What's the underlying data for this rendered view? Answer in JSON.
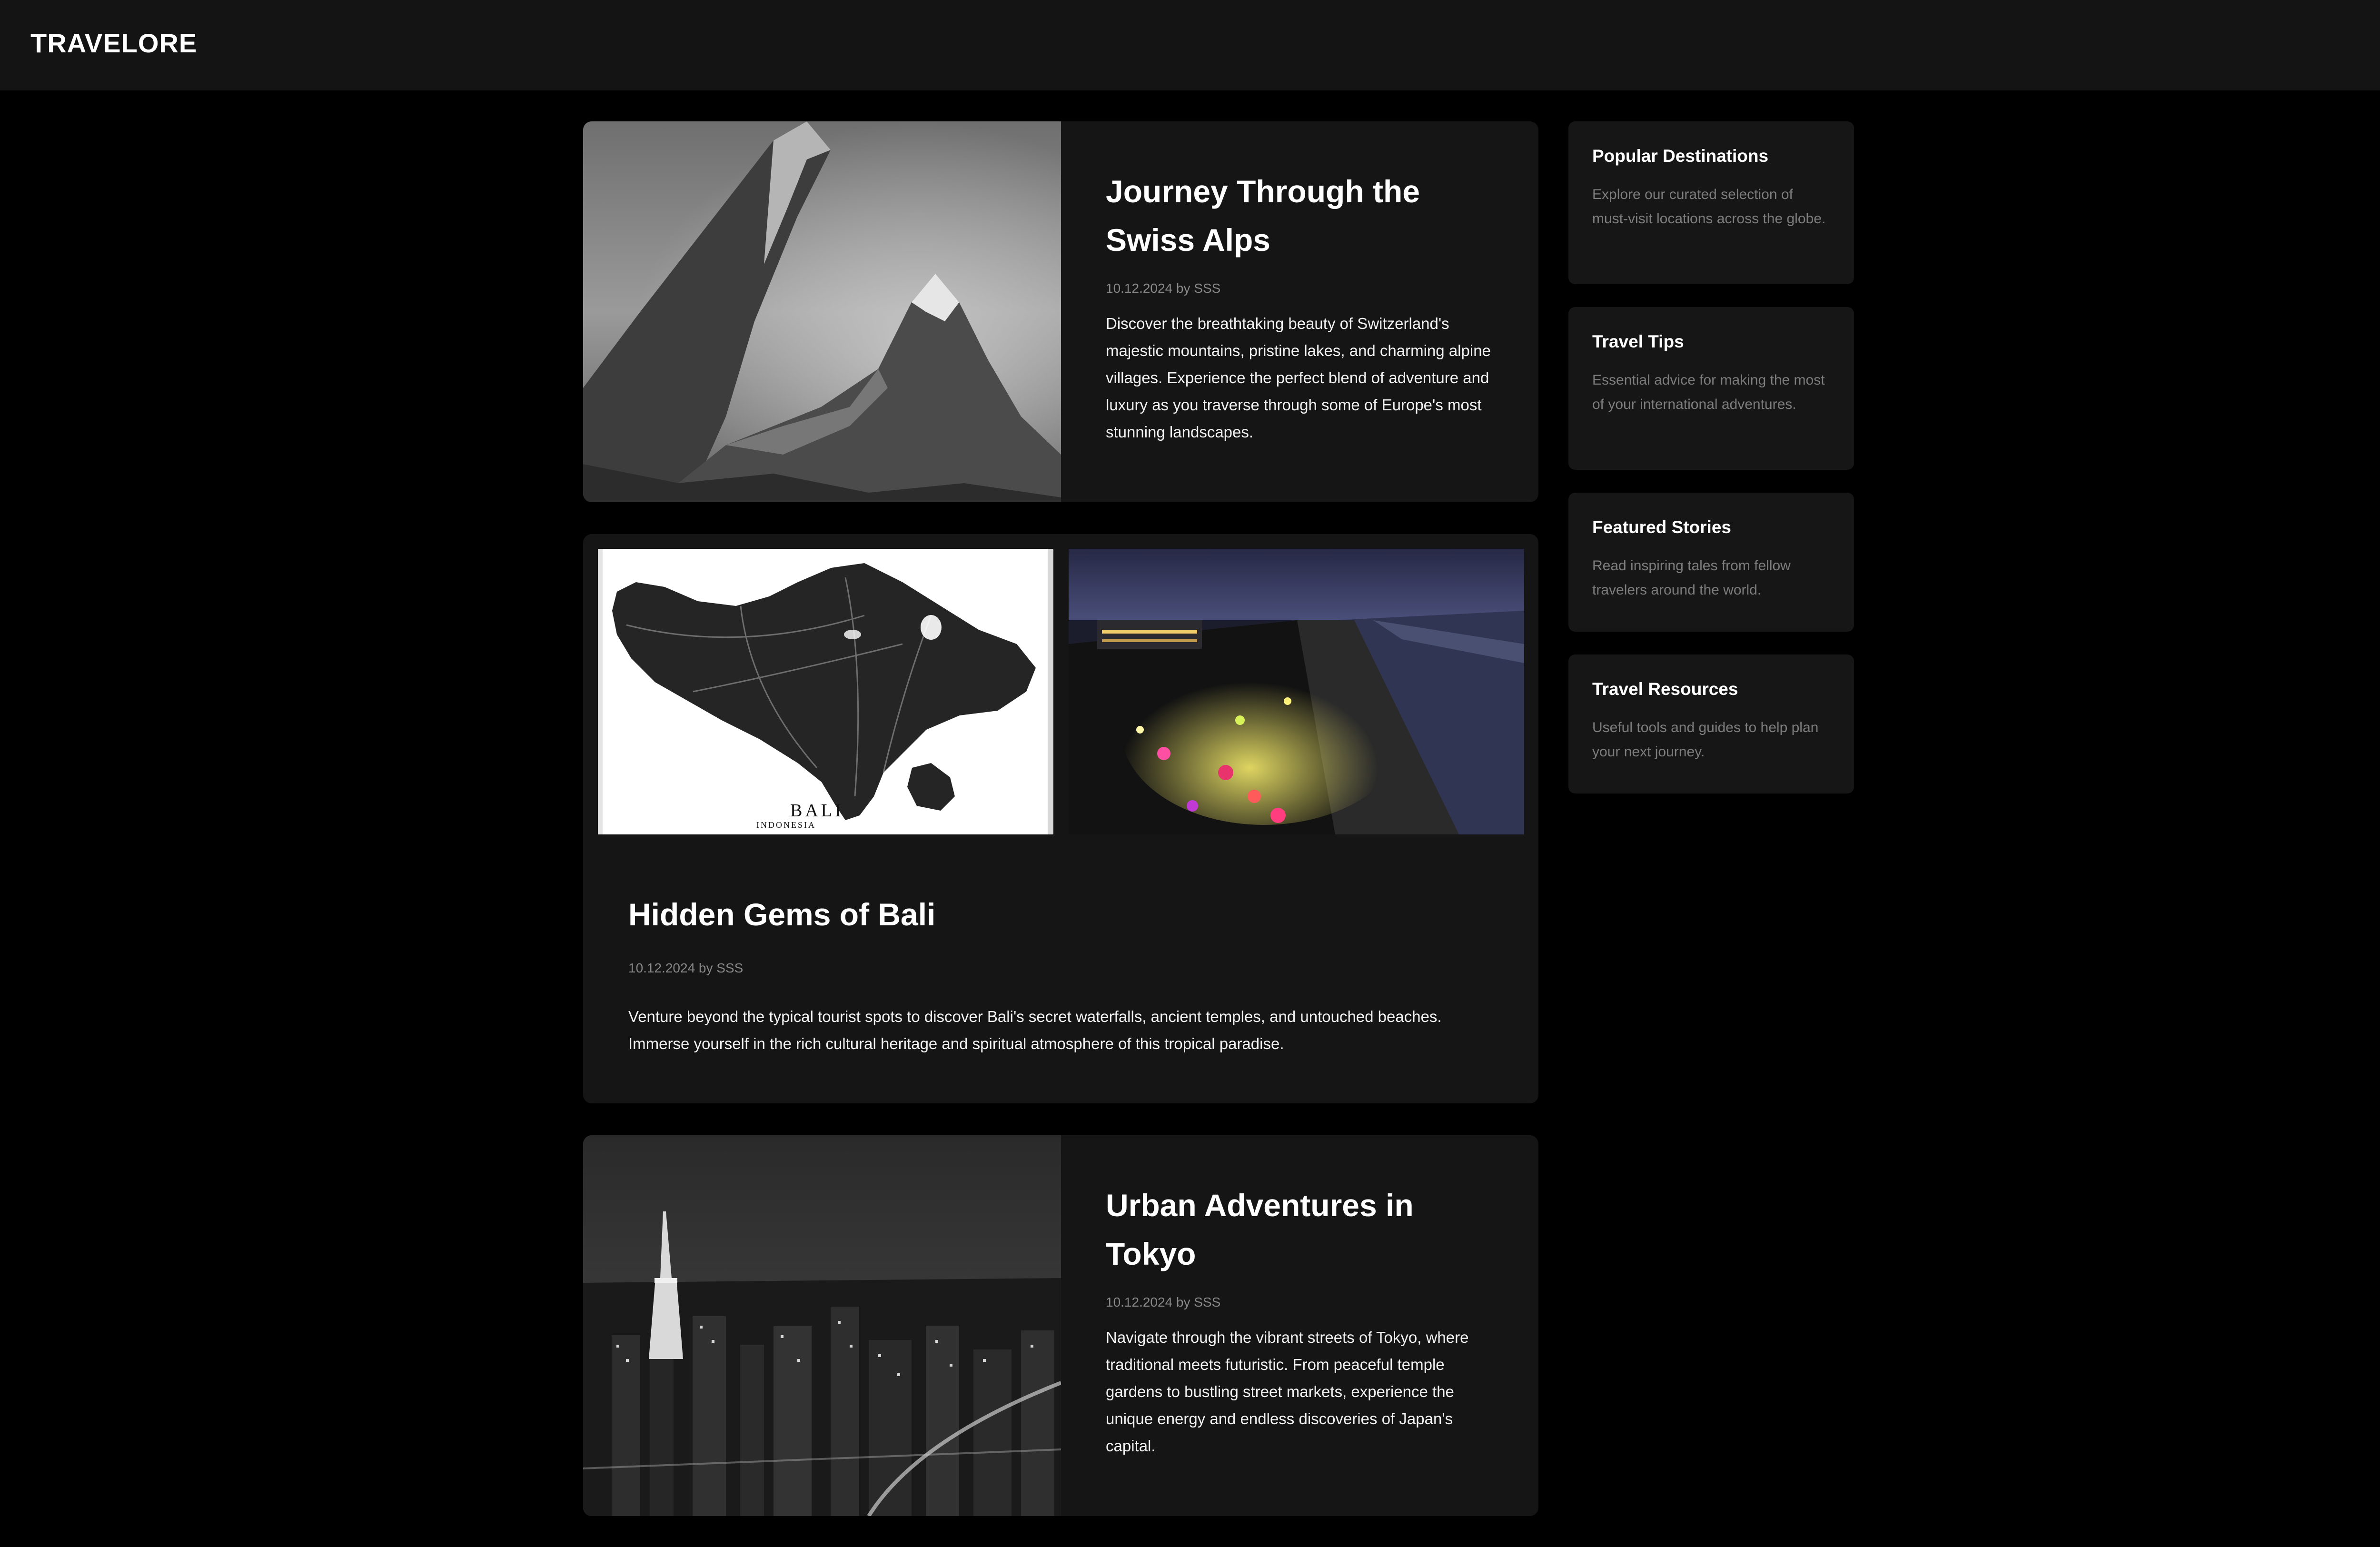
{
  "header": {
    "logo": "TRAVELORE"
  },
  "posts": [
    {
      "title": "Journey Through the Swiss Alps",
      "meta": "10.12.2024 by SSS",
      "body": "Discover the breathtaking beauty of Switzerland's majestic mountains, pristine lakes, and charming alpine villages. Experience the perfect blend of adventure and luxury as you traverse through some of Europe's most stunning landscapes."
    },
    {
      "title": "Hidden Gems of Bali",
      "meta": "10.12.2024 by SSS",
      "body": "Venture beyond the typical tourist spots to discover Bali's secret waterfalls, ancient temples, and untouched beaches. Immerse yourself in the rich cultural heritage and spiritual atmosphere of this tropical paradise.",
      "map_caption": "BALI",
      "map_subcaption": "INDONESIA"
    },
    {
      "title": "Urban Adventures in Tokyo",
      "meta": "10.12.2024 by SSS",
      "body": "Navigate through the vibrant streets of Tokyo, where traditional meets futuristic. From peaceful temple gardens to bustling street markets, experience the unique energy and endless discoveries of Japan's capital."
    }
  ],
  "sidebar": [
    {
      "title": "Popular Destinations",
      "text": "Explore our curated selection of must-visit locations across the globe."
    },
    {
      "title": "Travel Tips",
      "text": "Essential advice for making the most of your international adventures."
    },
    {
      "title": "Featured Stories",
      "text": "Read inspiring tales from fellow travelers around the world."
    },
    {
      "title": "Travel Resources",
      "text": "Useful tools and guides to help plan your next journey."
    }
  ]
}
